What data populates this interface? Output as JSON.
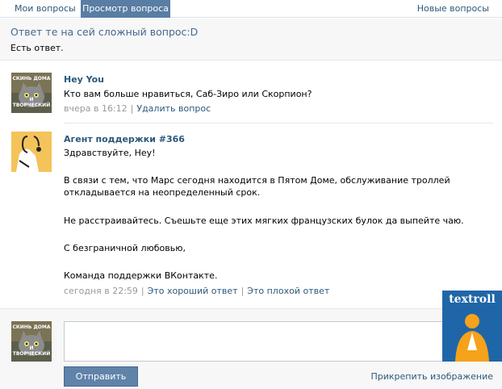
{
  "tabs": {
    "my_questions": "Мои вопросы",
    "view_question": "Просмотр вопроса",
    "new_questions": "Новые вопросы"
  },
  "question": {
    "title": "Ответ те на сей сложный вопрос:D",
    "body": "Есть ответ."
  },
  "posts": [
    {
      "author": "Hey You",
      "text": "Кто вам больше нравиться, Саб-Зиро или Скорпион?",
      "time": "вчера в 16:12",
      "action1": "Удалить вопрос",
      "avatar_caption_top": "СКИНЬ ДОМА",
      "avatar_caption_bottom": "И ТВОРЧЕСКИЙ"
    },
    {
      "author": "Агент поддержки #366",
      "lines": [
        "Здравствуйте, Hey!",
        "В связи с тем, что Марс сегодня находится в Пятом Доме, обслуживание троллей откладывается на неопределенный срок.",
        "Не расстраивайтесь. Съешьте еще этих мягких французских булок да выпейте чаю.",
        "С безграничной любовью,",
        "Команда поддержки ВКонтакте."
      ],
      "time": "сегодня в 22:59",
      "action1": "Это хороший ответ",
      "action2": "Это плохой ответ"
    }
  ],
  "reply": {
    "placeholder": "",
    "send_label": "Отправить",
    "attach_label": "Прикрепить изображение",
    "avatar_caption_top": "СКИНЬ ДОМА",
    "avatar_caption_bottom": "И ТВОРЧЕСКИЙ"
  },
  "watermark": {
    "text": "textroll"
  },
  "colors": {
    "accent": "#597da3",
    "link": "#2b587a",
    "button": "#6083a9",
    "watermark_bg": "#1f66a8",
    "watermark_figure": "#f6a21a"
  }
}
